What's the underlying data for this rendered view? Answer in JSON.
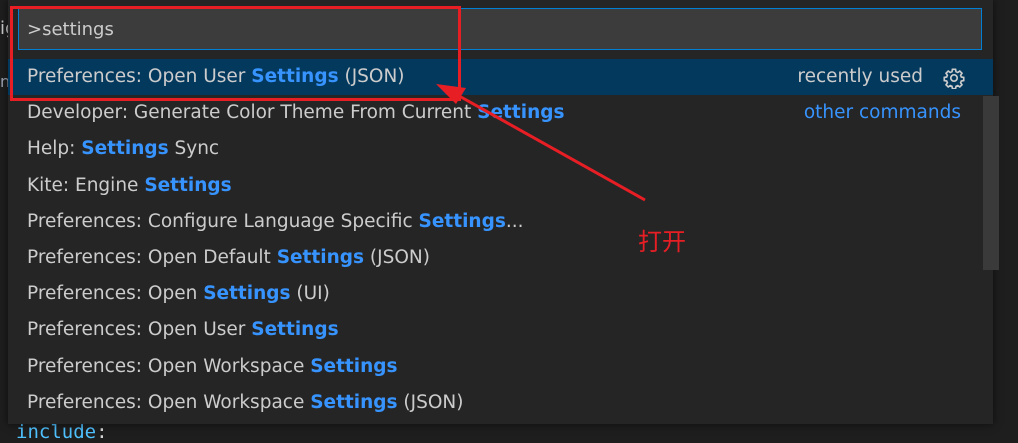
{
  "editor": {
    "fragment_top": "ig",
    "fragment_mid": "ni",
    "code_keyword": "include",
    "code_colon": ":"
  },
  "palette": {
    "input_value": ">settings",
    "items": [
      {
        "prefix": "Preferences: Open User ",
        "match": "Settings",
        "suffix": " (JSON)",
        "selected": true,
        "badge": "recently used",
        "icon": "gear-icon"
      },
      {
        "prefix": "Developer: Generate Color Theme From Current ",
        "match": "Settings",
        "suffix": "",
        "category": "other commands"
      },
      {
        "prefix": "Help: ",
        "match": "Settings",
        "suffix": " Sync"
      },
      {
        "prefix": "Kite: Engine ",
        "match": "Settings",
        "suffix": ""
      },
      {
        "prefix": "Preferences: Configure Language Specific ",
        "match": "Settings",
        "suffix": "..."
      },
      {
        "prefix": "Preferences: Open Default ",
        "match": "Settings",
        "suffix": " (JSON)"
      },
      {
        "prefix": "Preferences: Open ",
        "match": "Settings",
        "suffix": " (UI)"
      },
      {
        "prefix": "Preferences: Open User ",
        "match": "Settings",
        "suffix": ""
      },
      {
        "prefix": "Preferences: Open Workspace ",
        "match": "Settings",
        "suffix": ""
      },
      {
        "prefix": "Preferences: Open Workspace ",
        "match": "Settings",
        "suffix": " (JSON)"
      }
    ]
  },
  "annotation": {
    "text": "打开",
    "color": "#e81e25"
  },
  "colors": {
    "highlight": "#3794ff",
    "selected_bg": "#04395e",
    "input_border": "#007fd4"
  }
}
